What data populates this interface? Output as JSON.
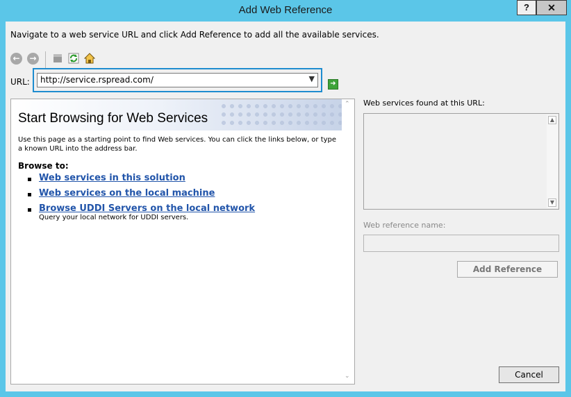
{
  "window": {
    "title": "Add Web Reference",
    "help_label": "?",
    "close_label": "✕"
  },
  "instruction": "Navigate to a web service URL and click Add Reference to add all the available services.",
  "toolbar": {
    "back_icon": "back-icon",
    "forward_icon": "forward-icon",
    "stop_icon": "stop-icon",
    "refresh_icon": "refresh-icon",
    "home_icon": "home-icon"
  },
  "url": {
    "label": "URL:",
    "value": "http://service.rspread.com/",
    "go_icon": "go-arrow-icon"
  },
  "browser": {
    "banner_title": "Start Browsing for Web Services",
    "intro": "Use this page as a starting point to find Web services. You can click the links below, or type a known URL into the address bar.",
    "browse_to": "Browse to:",
    "links": [
      {
        "label": "Web services in this solution",
        "desc": ""
      },
      {
        "label": "Web services on the local machine",
        "desc": ""
      },
      {
        "label": "Browse UDDI Servers on the local network",
        "desc": "Query your local network for UDDI servers."
      }
    ]
  },
  "right_panel": {
    "found_label": "Web services found at this URL:",
    "name_label": "Web reference name:",
    "name_value": "",
    "add_reference_label": "Add Reference"
  },
  "footer": {
    "cancel_label": "Cancel"
  },
  "colors": {
    "frame": "#5bc6e8",
    "focus": "#1e8ccf",
    "link": "#2255aa"
  }
}
